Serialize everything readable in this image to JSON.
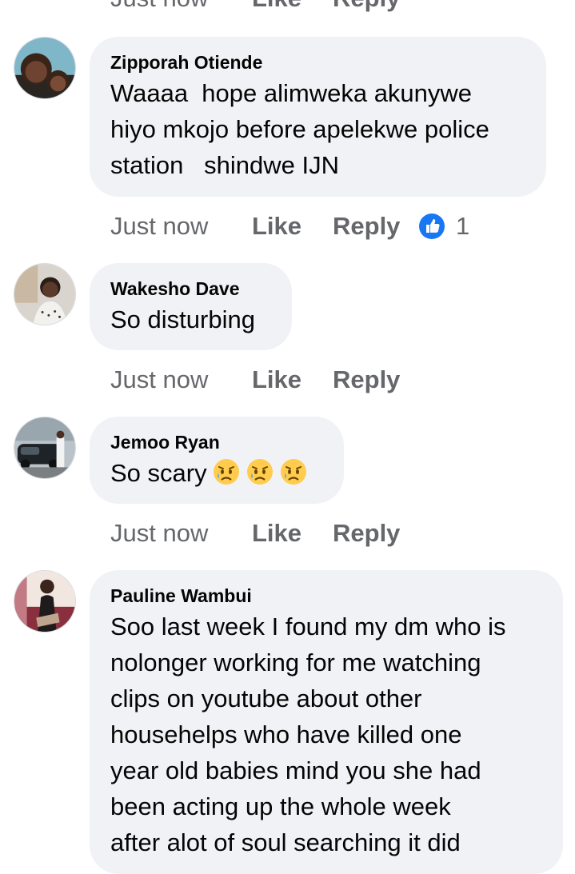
{
  "top_actions": {
    "time": "Just now",
    "like": "Like",
    "reply": "Reply"
  },
  "comments": [
    {
      "author": "Zipporah Otiende",
      "text": "Waaaa  hope alimweka akunywe\nhiyo mkojo before apelekwe police\nstation   shindwe IJN",
      "time": "Just now",
      "like": "Like",
      "reply": "Reply",
      "reaction_icon": "like-icon",
      "reaction_count": "1"
    },
    {
      "author": "Wakesho Dave",
      "text": "So disturbing",
      "time": "Just now",
      "like": "Like",
      "reply": "Reply"
    },
    {
      "author": "Jemoo Ryan",
      "text": "So scary",
      "emojis": [
        "sad-relieved-face-emoji",
        "sad-relieved-face-emoji",
        "sad-relieved-face-emoji"
      ],
      "time": "Just now",
      "like": "Like",
      "reply": "Reply"
    },
    {
      "author": "Pauline Wambui",
      "text": "Soo last week I found my dm who is\nnolonger working for me watching\nclips on youtube about other\nhousehelps who have killed one\nyear old babies mind you she had\nbeen acting up the whole week\nafter alot of soul searching it did"
    }
  ],
  "colors": {
    "bubble": "#f0f2f5",
    "secondary_text": "#65676b",
    "like_blue": "#1877f2"
  }
}
